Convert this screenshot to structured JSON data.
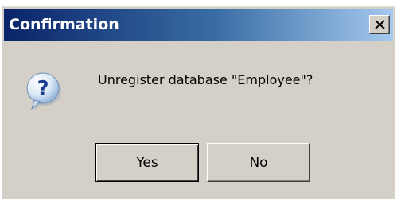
{
  "dialog": {
    "title": "Confirmation",
    "message": "Unregister database \"Employee\"?",
    "icon": "question-icon",
    "close_icon": "close-icon",
    "buttons": {
      "yes_label": "Yes",
      "no_label": "No"
    },
    "colors": {
      "face": "#d4d0c8",
      "title_start": "#0a246a",
      "title_end": "#a6caf0",
      "title_text": "#ffffff"
    }
  }
}
